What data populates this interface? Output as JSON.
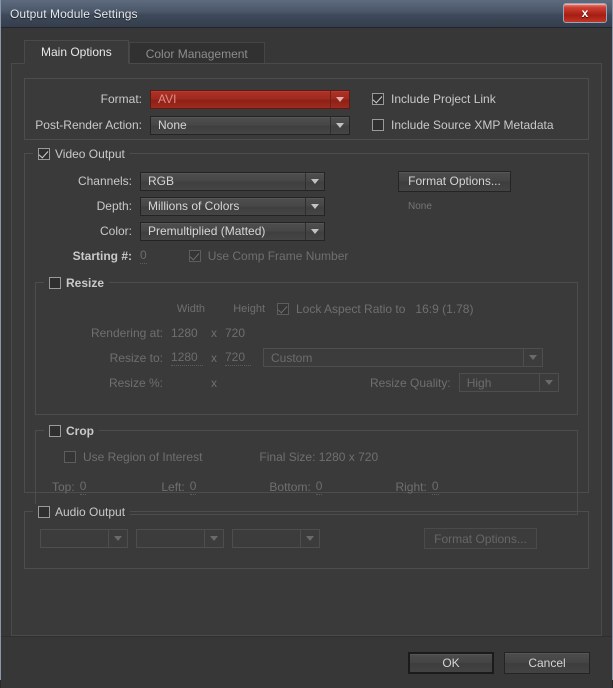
{
  "window": {
    "title": "Output Module Settings",
    "close_label": "x",
    "close_icon": "close-icon"
  },
  "tabs": [
    {
      "label": "Main Options",
      "active": true
    },
    {
      "label": "Color Management",
      "active": false
    }
  ],
  "format_section": {
    "format_label": "Format:",
    "format_value": "AVI",
    "post_render_label": "Post-Render Action:",
    "post_render_value": "None",
    "include_project_link_label": "Include Project Link",
    "include_project_link_checked": true,
    "include_xmp_label": "Include Source XMP Metadata",
    "include_xmp_checked": false
  },
  "video_output": {
    "legend": "Video Output",
    "checked": true,
    "channels_label": "Channels:",
    "channels_value": "RGB",
    "depth_label": "Depth:",
    "depth_value": "Millions of Colors",
    "color_label": "Color:",
    "color_value": "Premultiplied (Matted)",
    "starting_label": "Starting #:",
    "starting_value": "0",
    "use_comp_frame_label": "Use Comp Frame Number",
    "use_comp_frame_checked": true,
    "format_options_label": "Format Options...",
    "format_options_status": "None"
  },
  "resize": {
    "legend": "Resize",
    "checked": false,
    "width_header": "Width",
    "height_header": "Height",
    "lock_aspect_label": "Lock Aspect Ratio to",
    "lock_aspect_ratio": "16:9 (1.78)",
    "lock_aspect_checked": true,
    "rendering_at_label": "Rendering at:",
    "rendering_width": "1280",
    "rendering_x": "x",
    "rendering_height": "720",
    "resize_to_label": "Resize to:",
    "resize_width": "1280",
    "resize_x": "x",
    "resize_height": "720",
    "preset_value": "Custom",
    "resize_pct_label": "Resize %:",
    "resize_pct_x": "x",
    "quality_label": "Resize Quality:",
    "quality_value": "High"
  },
  "crop": {
    "legend": "Crop",
    "checked": false,
    "use_roi_label": "Use Region of Interest",
    "use_roi_checked": false,
    "final_size_label": "Final Size: 1280 x 720",
    "top_label": "Top:",
    "top_value": "0",
    "left_label": "Left:",
    "left_value": "0",
    "bottom_label": "Bottom:",
    "bottom_value": "0",
    "right_label": "Right:",
    "right_value": "0"
  },
  "audio_output": {
    "legend": "Audio Output",
    "checked": false,
    "rate_value": "",
    "depth_value": "",
    "channels_value": "",
    "format_options_label": "Format Options..."
  },
  "footer": {
    "ok_label": "OK",
    "cancel_label": "Cancel"
  },
  "colors": {
    "accent_red": "#9e2a20",
    "panel_bg": "#3a3a3a",
    "window_bg": "#373737",
    "titlebar": "#4a5668",
    "text": "#c9c9c9",
    "text_disabled": "#6f6f6f"
  }
}
